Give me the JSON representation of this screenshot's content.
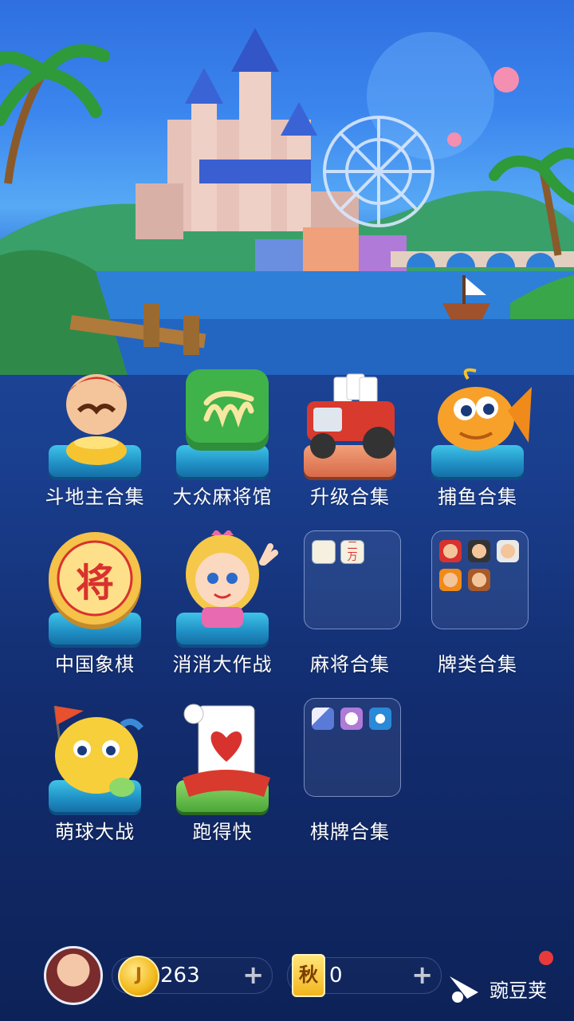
{
  "games": [
    {
      "label": "斗地主合集",
      "icon": "landlord-character-icon"
    },
    {
      "label": "大众麻将馆",
      "icon": "mahjong-tile-icon"
    },
    {
      "label": "升级合集",
      "icon": "tractor-cards-icon"
    },
    {
      "label": "捕鱼合集",
      "icon": "fish-icon"
    },
    {
      "label": "中国象棋",
      "icon": "chinese-chess-icon",
      "glyph": "将"
    },
    {
      "label": "消消大作战",
      "icon": "princess-icon"
    },
    {
      "label": "麻将合集",
      "icon": "mahjong-folder-icon"
    },
    {
      "label": "牌类合集",
      "icon": "cards-folder-icon"
    },
    {
      "label": "萌球大战",
      "icon": "cute-ball-icon"
    },
    {
      "label": "跑得快",
      "icon": "running-card-icon"
    },
    {
      "label": "棋牌合集",
      "icon": "board-games-folder-icon"
    }
  ],
  "mahjong_folder_tiles": [
    "二",
    "万"
  ],
  "bottom_bar": {
    "coins": "263",
    "autumn_badge": "秋",
    "autumn_value": "0",
    "plus_symbol": "+",
    "watermark": "豌豆荚"
  },
  "colors": {
    "accent": "#3fc3e8",
    "background": "#1a3f8f",
    "notification": "#e83a3a"
  }
}
